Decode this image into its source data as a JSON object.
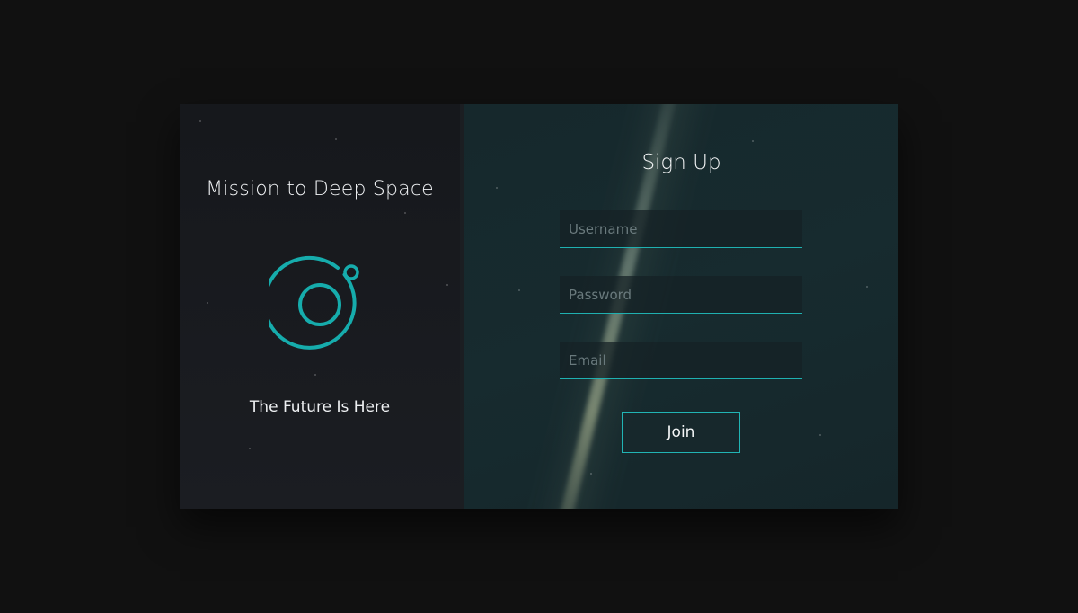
{
  "left_panel": {
    "title": "Mission to Deep Space",
    "tagline": "The Future Is Here",
    "logo_icon": "orbit-planet-icon"
  },
  "signup": {
    "title": "Sign Up",
    "fields": {
      "username": {
        "value": "",
        "placeholder": "Username"
      },
      "password": {
        "value": "",
        "placeholder": "Password"
      },
      "email": {
        "value": "",
        "placeholder": "Email"
      }
    },
    "join_label": "Join"
  },
  "colors": {
    "accent": "#1fb0b0",
    "page_background": "#111111",
    "left_panel_background": "#181a1f",
    "right_panel_background": "#16292d",
    "text": "#ffffff"
  }
}
